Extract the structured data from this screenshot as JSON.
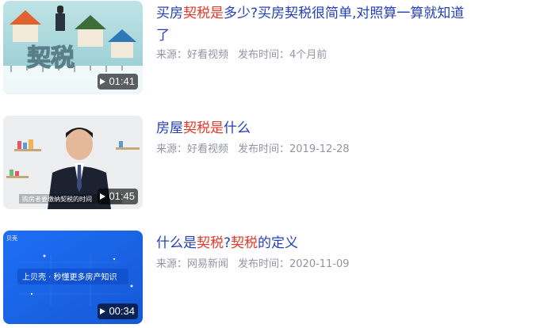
{
  "results": [
    {
      "title_parts": [
        {
          "text": "买房",
          "hl": false
        },
        {
          "text": "契税",
          "hl": true
        },
        {
          "text": "是",
          "hl": true
        },
        {
          "text": "多少?买房契税很简单,对照算一算就知道了",
          "hl": false
        }
      ],
      "source": "来源：好看视频",
      "publish": "发布时间：4个月前",
      "duration": "01:41",
      "thumb_text": "契税"
    },
    {
      "title_parts": [
        {
          "text": "房屋",
          "hl": false
        },
        {
          "text": "契税",
          "hl": true
        },
        {
          "text": "是",
          "hl": true
        },
        {
          "text": "什么",
          "hl": false
        }
      ],
      "source": "来源：好看视频",
      "publish": "发布时间：2019-12-28",
      "duration": "01:45",
      "thumb_text": "购房者要缴纳契税的时间"
    },
    {
      "title_parts": [
        {
          "text": "什么是",
          "hl": false
        },
        {
          "text": "契税",
          "hl": true
        },
        {
          "text": "?",
          "hl": false
        },
        {
          "text": "契税",
          "hl": true
        },
        {
          "text": "的定义",
          "hl": false
        }
      ],
      "source": "来源：网易新闻",
      "publish": "发布时间：2020-11-09",
      "duration": "00:34",
      "thumb_text": "上贝壳 · 秒懂更多房产知识",
      "thumb_logo": "贝壳"
    }
  ],
  "colors": {
    "title": "#2440b3",
    "highlight": "#e23a2a",
    "meta": "#9195a3"
  }
}
